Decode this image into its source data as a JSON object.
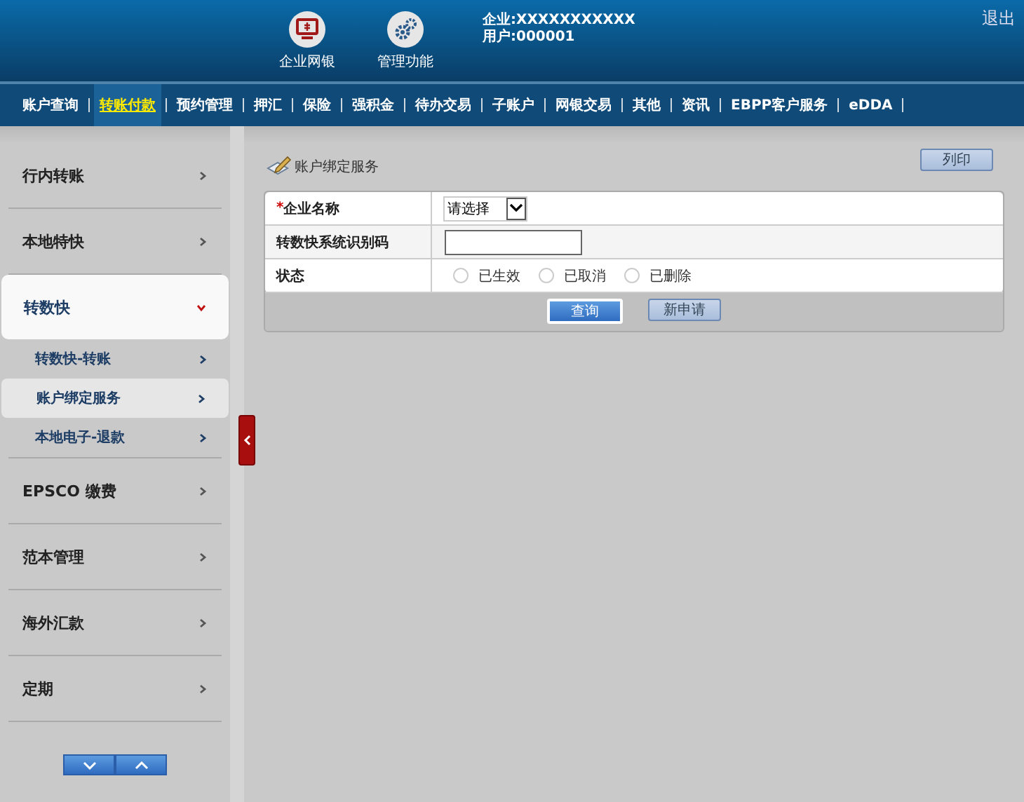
{
  "header": {
    "apps": [
      {
        "label": "企业网银",
        "kind": "monitor"
      },
      {
        "label": "管理功能",
        "kind": "gears"
      }
    ],
    "company": "企业:XXXXXXXXXXX",
    "user": "用户:000001",
    "logout": "退出"
  },
  "nav": [
    {
      "label": "账户查询",
      "selected": false
    },
    {
      "label": "转账付款",
      "selected": true
    },
    {
      "label": "预约管理",
      "selected": false
    },
    {
      "label": "押汇",
      "selected": false
    },
    {
      "label": "保险",
      "selected": false
    },
    {
      "label": "强积金",
      "selected": false
    },
    {
      "label": "待办交易",
      "selected": false
    },
    {
      "label": "子账户",
      "selected": false
    },
    {
      "label": "网银交易",
      "selected": false
    },
    {
      "label": "其他",
      "selected": false
    },
    {
      "label": "资讯",
      "selected": false
    },
    {
      "label": "EBPP客户服务",
      "selected": false
    },
    {
      "label": "eDDA",
      "selected": false
    }
  ],
  "sidebar": {
    "items": [
      {
        "label": "行内转账",
        "expanded": false
      },
      {
        "label": "本地特快",
        "expanded": false
      },
      {
        "label": "转数快",
        "expanded": true,
        "children": [
          {
            "label": "转数快-转账",
            "selected": false
          },
          {
            "label": "账户绑定服务",
            "selected": true
          },
          {
            "label": "本地电子-退款",
            "selected": false
          }
        ]
      },
      {
        "label": "EPSCO 缴费",
        "expanded": false
      },
      {
        "label": "范本管理",
        "expanded": false
      },
      {
        "label": "海外汇款",
        "expanded": false
      },
      {
        "label": "定期",
        "expanded": false
      }
    ]
  },
  "page": {
    "title": "账户绑定服务",
    "print_button": "列印",
    "form": [
      {
        "kind": "select",
        "label": "企业名称",
        "mark": "*",
        "value": "请选择"
      },
      {
        "kind": "text",
        "label": "转数快系统识别码"
      },
      {
        "kind": "radio",
        "label": "状态",
        "options": [
          {
            "label": "已生效",
            "selected": false
          },
          {
            "label": "已取消",
            "selected": false
          },
          {
            "label": "已删除",
            "selected": false
          }
        ]
      }
    ],
    "buttons": [
      {
        "label": "查询",
        "primary": true
      },
      {
        "label": "新申请",
        "primary": false
      }
    ]
  }
}
